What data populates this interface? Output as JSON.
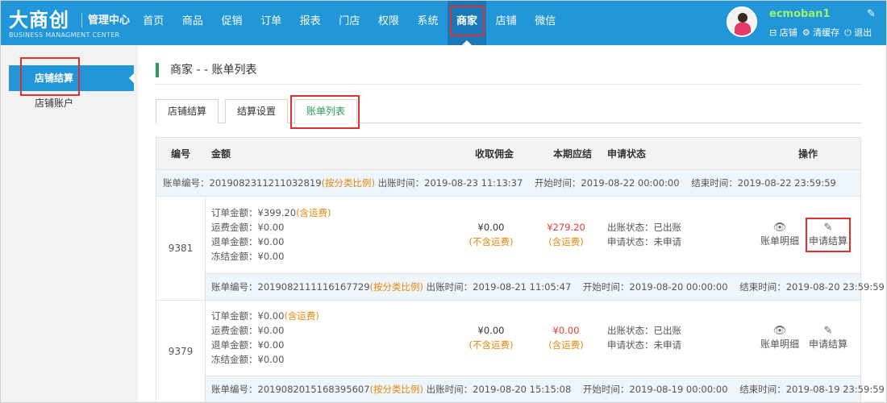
{
  "header": {
    "logo": "大商创",
    "logo_sub": "管理中心",
    "logo_en": "BUSINESS MANAGMENT CENTER",
    "nav": [
      "首页",
      "商品",
      "促销",
      "订单",
      "报表",
      "门店",
      "权限",
      "系统",
      "商家",
      "店铺",
      "微信"
    ],
    "active_nav": "商家",
    "username": "ecmoban1",
    "links": {
      "shop": "⊟ 店铺",
      "clear_cache": "⚙ 清缓存",
      "logout": "⏻ 退出"
    }
  },
  "sidebar": {
    "items": [
      {
        "label": "店铺结算",
        "active": true
      },
      {
        "label": "店铺账户",
        "active": false
      }
    ]
  },
  "page": {
    "title": "商家 - - 账单列表",
    "tabs": [
      "店铺结算",
      "结算设置",
      "账单列表"
    ],
    "active_tab": "账单列表"
  },
  "table": {
    "headers": {
      "id": "编号",
      "amount": "金额",
      "commission": "收取佣金",
      "due": "本期应结",
      "status": "申请状态",
      "ops": "操作"
    },
    "top_bill": {
      "no_label": "账单编号：",
      "no": "2019082311211032819",
      "ratio": "(按分类比例)",
      "times": "出账时间：2019-08-23 11:13:37    开始时间：2019-08-22 00:00:00    结束时间：2019-08-22 23:59:59"
    },
    "entries": [
      {
        "id": "9381",
        "order_amount_label": "订单金额：",
        "order_amount": "¥399.20",
        "order_note": "(含运费)",
        "shipping": "运费金额：¥0.00",
        "refund": "退单金额：¥0.00",
        "frozen": "冻结金额：¥0.00",
        "commission": "¥0.00",
        "commission_note": "(不含运费)",
        "due": "¥279.20",
        "due_note": "(含运费)",
        "bill_status": "出账状态：已出账",
        "apply_status": "申请状态：未申请",
        "op_detail": "账单明细",
        "op_apply": "申请结算",
        "bill": {
          "no_label": "账单编号：",
          "no": "2019082111116167729",
          "ratio": "(按分类比例)",
          "times": "出账时间：2019-08-21 11:05:47    开始时间：2019-08-20 00:00:00    结束时间：2019-08-20 23:59:59"
        }
      },
      {
        "id": "9379",
        "order_amount_label": "订单金额：",
        "order_amount": "¥0.00",
        "order_note": "(含运费)",
        "shipping": "运费金额：¥0.00",
        "refund": "退单金额：¥0.00",
        "frozen": "冻结金额：¥0.00",
        "commission": "¥0.00",
        "commission_note": "(不含运费)",
        "due": "¥0.00",
        "due_note": "(含运费)",
        "bill_status": "出账状态：已出账",
        "apply_status": "申请状态：未申请",
        "op_detail": "账单明细",
        "op_apply": "申请结算",
        "bill": {
          "no_label": "账单编号：",
          "no": "2019082015168395607",
          "ratio": "(按分类比例)",
          "times": "出账时间：2019-08-20 15:15:08    开始时间：2019-08-19 00:00:00    结束时间：2019-08-19 23:59:59"
        }
      }
    ]
  },
  "colors": {
    "primary": "#2196d8",
    "accent_green": "#2a9b5a",
    "highlight_red": "#e03030",
    "orange": "#e8860a"
  }
}
